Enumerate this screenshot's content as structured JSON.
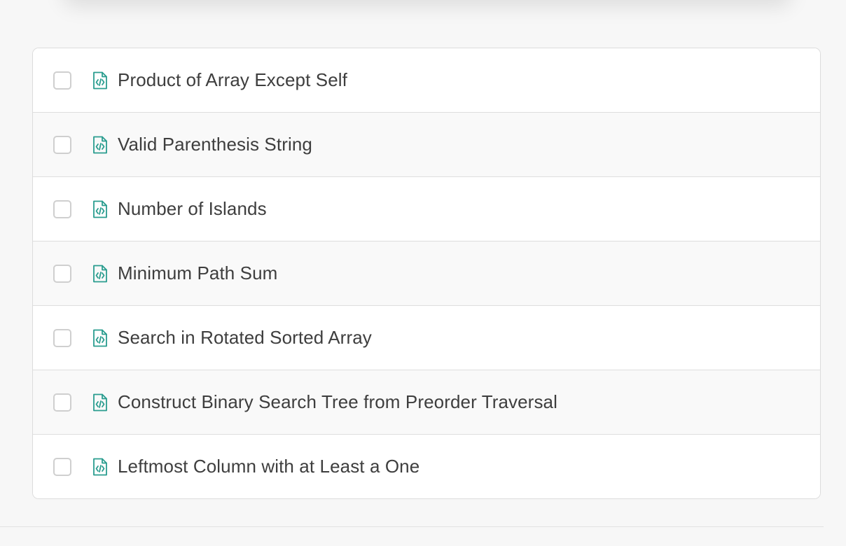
{
  "accent_color": "#2a9d8f",
  "problems": [
    {
      "title": "Product of Array Except Self",
      "icon": "code-file-icon",
      "checked": false
    },
    {
      "title": "Valid Parenthesis String",
      "icon": "code-file-icon",
      "checked": false
    },
    {
      "title": "Number of Islands",
      "icon": "code-file-icon",
      "checked": false
    },
    {
      "title": "Minimum Path Sum",
      "icon": "code-file-icon",
      "checked": false
    },
    {
      "title": "Search in Rotated Sorted Array",
      "icon": "code-file-icon",
      "checked": false
    },
    {
      "title": "Construct Binary Search Tree from Preorder Traversal",
      "icon": "code-file-icon",
      "checked": false
    },
    {
      "title": "Leftmost Column with at Least a One",
      "icon": "code-file-icon",
      "checked": false
    }
  ]
}
